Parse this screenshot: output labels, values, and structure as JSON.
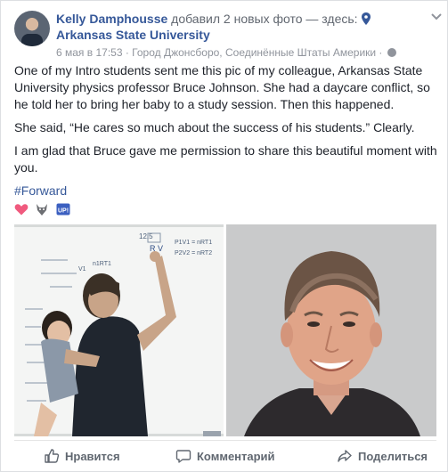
{
  "post": {
    "author": "Kelly Damphousse",
    "action": "добавил 2 новых фото — здесь:",
    "place": "Arkansas State University",
    "meta": "6 мая в 17:53 · Город Джонсборо, Соединённые Штаты Америки ·",
    "paragraphs": [
      "One of my Intro students sent me this pic of my colleague, Arkansas State University physics professor Bruce Johnson. She had a daycare conflict, so he told her to bring her baby to a study session. Then this happened.",
      "She said, “He cares so much about the success of his students.” Clearly.",
      "I am glad that Bruce gave me permission to share this beautiful moment with you."
    ],
    "hashtag": "#Forward",
    "reactions": [
      "love-reaction-icon",
      "wolf-reaction-icon",
      "up-reaction-icon"
    ],
    "photo_labels": [
      "whiteboard-photo",
      "portrait-photo"
    ],
    "board_text": [
      "12.5",
      "R V",
      "P1V1 = nRT1",
      "P2V2 = nRT2",
      "V1",
      "n1RT1"
    ]
  },
  "actions": {
    "like": "Нравится",
    "comment": "Комментарий",
    "share": "Поделиться"
  },
  "colors": {
    "link": "#365899",
    "muted": "#90949c",
    "text": "#1d2129",
    "action_text": "#606770"
  }
}
